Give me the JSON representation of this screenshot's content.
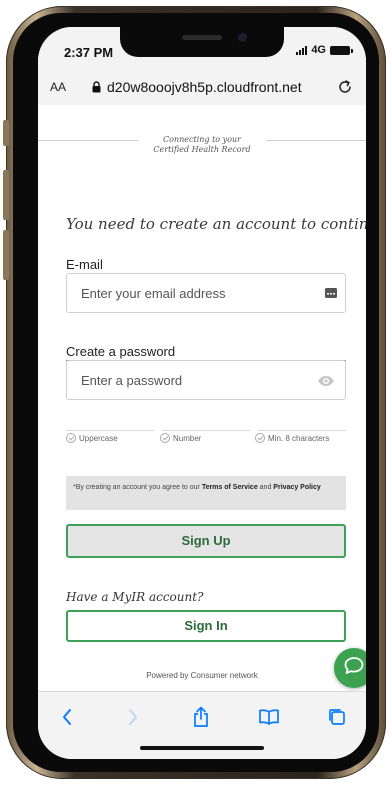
{
  "status_bar": {
    "time": "2:37 PM",
    "network": "4G"
  },
  "address_bar": {
    "aa_label": "AA",
    "url": "d20w8ooojv8h5p.cloudfront.net"
  },
  "connecting": {
    "line1": "Connecting to your",
    "line2": "Certified Health Record"
  },
  "form": {
    "heading": "You need to create an account to continue.",
    "email_label": "E-mail",
    "email_placeholder": "Enter your email address",
    "password_label": "Create a password",
    "password_placeholder": "Enter a password",
    "requirements": [
      "Uppercase",
      "Number",
      "Min. 8 characters"
    ],
    "terms_prefix": "*By creating an account you agree to our ",
    "terms_link": "Terms of Service",
    "terms_and": " and ",
    "privacy_link": "Privacy Policy",
    "signup_label": "Sign Up",
    "have_account": "Have a MyIR account?",
    "signin_label": "Sign In",
    "powered_by": "Powered by Consumer network"
  },
  "colors": {
    "accent_green": "#3fa058",
    "ios_blue": "#0a7bff"
  },
  "icons": {
    "email_field": "autofill-card-icon",
    "password_field": "eye-icon",
    "chat": "chat-bubble-icon",
    "toolbar": [
      "back-chevron-icon",
      "forward-chevron-icon",
      "share-icon",
      "bookmarks-icon",
      "tabs-icon"
    ]
  }
}
